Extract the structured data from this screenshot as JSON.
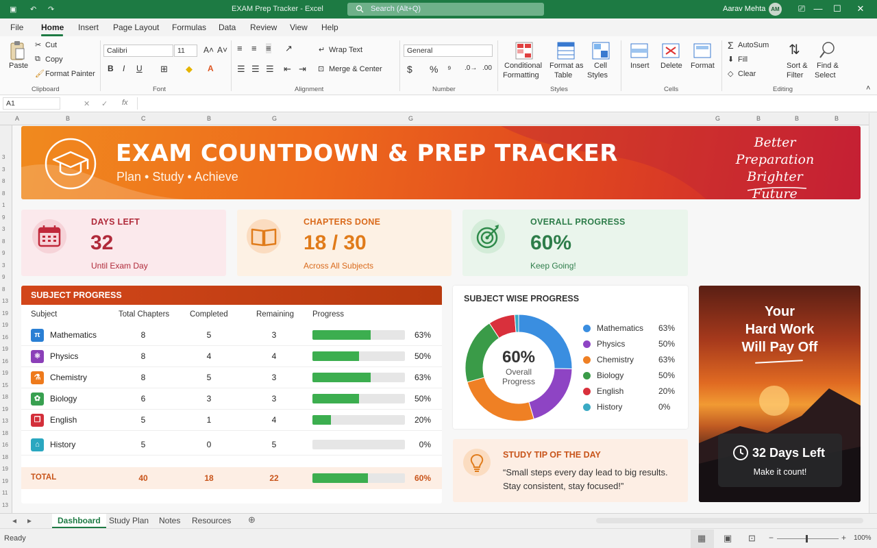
{
  "titlebar": {
    "doc_title": "EXAM Prep Tracker - Excel",
    "search_placeholder": "Search (Alt+Q)",
    "user_name": "Aarav Mehta",
    "user_initials": "AM"
  },
  "menu": [
    "File",
    "Home",
    "Insert",
    "Page Layout",
    "Formulas",
    "Data",
    "Review",
    "View",
    "Help"
  ],
  "ribbon": {
    "clipboard": {
      "paste": "Paste",
      "cut": "Cut",
      "copy": "Copy",
      "format_painter": "Format Painter",
      "group": "Clipboard"
    },
    "font": {
      "family": "Calibri",
      "size": "11",
      "group": "Font"
    },
    "alignment": {
      "wrap": "Wrap Text",
      "merge": "Merge & Center",
      "group": "Alignment"
    },
    "number": {
      "format": "General",
      "group": "Number"
    },
    "styles": {
      "conditional": "Conditional",
      "conditional2": "Formatting",
      "format_table": "Format as",
      "format_table2": "Table",
      "cell_styles": "Cell",
      "cell_styles2": "Styles",
      "group": "Styles"
    },
    "cells": {
      "insert": "Insert",
      "delete": "Delete",
      "format": "Format",
      "group": "Cells"
    },
    "editing": {
      "autosum": "AutoSum",
      "fill": "Fill",
      "clear": "Clear",
      "sort": "Sort &",
      "sort2": "Filter",
      "find": "Find &",
      "find2": "Select",
      "group": "Editing"
    }
  },
  "formula_bar": {
    "name_box": "A1",
    "fx": "fx"
  },
  "banner": {
    "title": "EXAM COUNTDOWN & PREP TRACKER",
    "subtitle": "Plan  •  Study  •  Achieve",
    "quote1": "Better",
    "quote2": "Preparation",
    "quote3": "Brighter Future"
  },
  "kpis": [
    {
      "label": "DAYS LEFT",
      "value": "32",
      "note": "Until Exam Day",
      "color": "#c0283a"
    },
    {
      "label": "CHAPTERS DONE",
      "value": "18 / 30",
      "note": "Across All Subjects",
      "color": "#e07b1a"
    },
    {
      "label": "OVERALL PROGRESS",
      "value": "60%",
      "note": "Keep Going!",
      "color": "#2e7d4a"
    }
  ],
  "subject_progress": {
    "title": "SUBJECT PROGRESS",
    "headers": [
      "Subject",
      "Total Chapters",
      "Completed",
      "Remaining",
      "Progress"
    ],
    "rows": [
      {
        "subject": "Mathematics",
        "total": "8",
        "completed": "5",
        "remaining": "3",
        "progress": 0.63,
        "pct": "63%",
        "icon": "pi-icon",
        "icon_color": "#2a7fd4",
        "glyph": "π"
      },
      {
        "subject": "Physics",
        "total": "8",
        "completed": "4",
        "remaining": "4",
        "progress": 0.5,
        "pct": "50%",
        "icon": "atom-icon",
        "icon_color": "#8b3fb8",
        "glyph": "⚛"
      },
      {
        "subject": "Chemistry",
        "total": "8",
        "completed": "5",
        "remaining": "3",
        "progress": 0.63,
        "pct": "63%",
        "icon": "flask-icon",
        "icon_color": "#ee7a1c",
        "glyph": "⚗"
      },
      {
        "subject": "Biology",
        "total": "6",
        "completed": "3",
        "remaining": "3",
        "progress": 0.5,
        "pct": "50%",
        "icon": "leaf-icon",
        "icon_color": "#38a050",
        "glyph": "✿"
      },
      {
        "subject": "English",
        "total": "5",
        "completed": "1",
        "remaining": "4",
        "progress": 0.2,
        "pct": "20%",
        "icon": "book-icon",
        "icon_color": "#d32f3a",
        "glyph": "❐"
      },
      {
        "subject": "History",
        "total": "5",
        "completed": "0",
        "remaining": "5",
        "progress": 0.0,
        "pct": "0%",
        "icon": "museum-icon",
        "icon_color": "#2aa7c0",
        "glyph": "⌂"
      }
    ],
    "total": {
      "label": "TOTAL",
      "total": "40",
      "completed": "18",
      "remaining": "22",
      "progress": 0.6,
      "pct": "60%"
    }
  },
  "donut": {
    "title": "SUBJECT WISE PROGRESS",
    "center_value": "60%",
    "center_label1": "Overall",
    "center_label2": "Progress",
    "legend": [
      {
        "name": "Mathematics",
        "pct": "63%",
        "color": "#3a8ee0"
      },
      {
        "name": "Physics",
        "pct": "50%",
        "color": "#8e44c4"
      },
      {
        "name": "Chemistry",
        "pct": "63%",
        "color": "#ef8024"
      },
      {
        "name": "Biology",
        "pct": "50%",
        "color": "#3a9b48"
      },
      {
        "name": "English",
        "pct": "20%",
        "color": "#d9303c"
      },
      {
        "name": "History",
        "pct": "0%",
        "color": "#3aaac4"
      }
    ]
  },
  "tip": {
    "title": "STUDY TIP OF THE DAY",
    "line1": "“Small steps every day lead to big results.",
    "line2": "Stay consistent, stay focused!”"
  },
  "motivation": {
    "line1": "Your",
    "line2": "Hard Work",
    "line3": "Will Pay Off",
    "countdown": "32 Days Left",
    "cta": "Make it count!"
  },
  "sheets": [
    "Dashboard",
    "Study Plan",
    "Notes",
    "Resources"
  ],
  "status": {
    "ready": "Ready",
    "zoom": "100%"
  }
}
